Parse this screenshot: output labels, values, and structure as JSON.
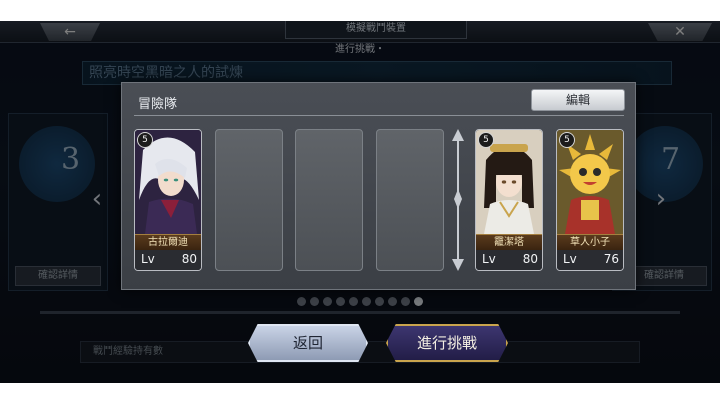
{
  "header": {
    "title": "模擬戰鬥裝置",
    "subtitle": "進行挑戰・",
    "back_symbol": "←",
    "close_symbol": "✕"
  },
  "background": {
    "quest_banner": "照亮時空黑暗之人的試煉",
    "left_stage_num": "3",
    "right_stage_num": "7",
    "left_detail_btn": "確認詳情",
    "right_detail_btn": "確認詳情",
    "bottom_strip": "戰鬥經驗持有數",
    "page_dot_count": 10,
    "active_dot_index": 9
  },
  "modal": {
    "title": "冒險隊",
    "edit_button": "編輯",
    "cards": [
      {
        "slot": "main-1",
        "filled": true,
        "name": "古拉爾迪",
        "level_label": "Lv",
        "level": "80",
        "rank": "5",
        "theme": "silver-haired-mage"
      },
      {
        "slot": "main-2",
        "filled": false
      },
      {
        "slot": "main-3",
        "filled": false
      },
      {
        "slot": "main-4",
        "filled": false
      },
      {
        "slot": "support-1",
        "filled": true,
        "name": "龗潔塔",
        "level_label": "Lv",
        "level": "80",
        "rank": "5",
        "theme": "dark-haired-girl"
      },
      {
        "slot": "support-2",
        "filled": true,
        "name": "草人小子",
        "level_label": "Lv",
        "level": "76",
        "rank": "5",
        "theme": "golden-creature"
      }
    ]
  },
  "buttons": {
    "back": "返回",
    "start": "進行挑戰"
  },
  "colors": {
    "accent_gold": "#c9a44d",
    "modal_bg": "#44484e",
    "start_btn_bg": "#2f2960"
  }
}
